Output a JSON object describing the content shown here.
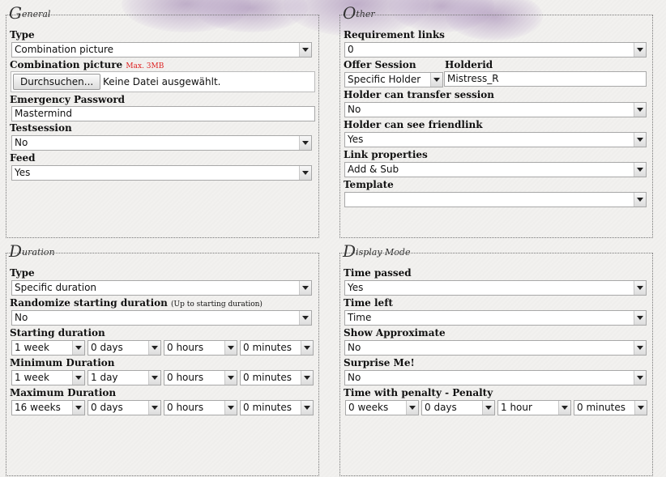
{
  "general": {
    "legend_cap": "G",
    "legend_rest": "eneral",
    "type_label": "Type",
    "type_value": "Combination picture",
    "combo_label": "Combination picture",
    "combo_note": "Max. 3MB",
    "file_button": "Durchsuchen...",
    "file_status": "Keine Datei ausgewählt.",
    "password_label": "Emergency Password",
    "password_value": "Mastermind",
    "testsession_label": "Testsession",
    "testsession_value": "No",
    "feed_label": "Feed",
    "feed_value": "Yes"
  },
  "other": {
    "legend_cap": "O",
    "legend_rest": "ther",
    "req_label": "Requirement links",
    "req_value": "0",
    "offer_label": "Offer Session",
    "offer_value": "Specific Holder",
    "holderid_label": "Holderid",
    "holderid_value": "Mistress_R",
    "transfer_label": "Holder can transfer session",
    "transfer_value": "No",
    "friendlink_label": "Holder can see friendlink",
    "friendlink_value": "Yes",
    "linkprops_label": "Link properties",
    "linkprops_value": "Add & Sub",
    "template_label": "Template",
    "template_value": ""
  },
  "duration": {
    "legend_cap": "D",
    "legend_rest": "uration",
    "type_label": "Type",
    "type_value": "Specific duration",
    "randomize_label": "Randomize starting duration",
    "randomize_note": "(Up to starting duration)",
    "randomize_value": "No",
    "start_label": "Starting duration",
    "start_weeks": "1 week",
    "start_days": "0 days",
    "start_hours": "0 hours",
    "start_minutes": "0 minutes",
    "min_label": "Minimum Duration",
    "min_weeks": "1 week",
    "min_days": "1 day",
    "min_hours": "0 hours",
    "min_minutes": "0 minutes",
    "max_label": "Maximum Duration",
    "max_weeks": "16 weeks",
    "max_days": "0 days",
    "max_hours": "0 hours",
    "max_minutes": "0 minutes"
  },
  "display": {
    "legend_cap": "D",
    "legend_rest": "isplay Mode",
    "passed_label": "Time passed",
    "passed_value": "Yes",
    "left_label": "Time left",
    "left_value": "Time",
    "approx_label": "Show Approximate",
    "approx_value": "No",
    "surprise_label": "Surprise Me!",
    "surprise_value": "No",
    "penalty_label": "Time with penalty - Penalty",
    "penalty_weeks": "0 weeks",
    "penalty_days": "0 days",
    "penalty_hours": "1 hour",
    "penalty_minutes": "0 minutes"
  }
}
